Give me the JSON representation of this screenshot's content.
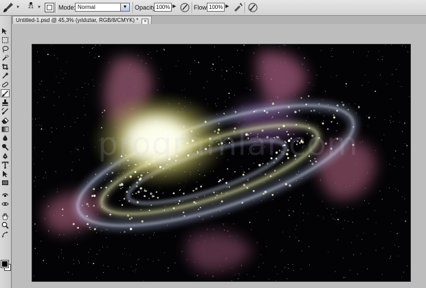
{
  "options_bar": {
    "brush_size": "21",
    "mode_label": "Mode:",
    "mode_value": "Normal",
    "opacity_label": "Opacity:",
    "opacity_value": "100%",
    "flow_label": "Flow:",
    "flow_value": "100%",
    "icons": [
      "brush-tool-icon",
      "brush-panel-toggle-icon",
      "pen-pressure-opacity-icon",
      "airbrush-icon",
      "pen-pressure-size-icon"
    ]
  },
  "document": {
    "tab_title": "Untitled-1.psd @ 45,3% (yıldızlar, RGB/8/CMYK) *",
    "close_glyph": "×"
  },
  "canvas": {
    "watermark": "programlar.com",
    "background_color": "#030305"
  },
  "tools": [
    "move-tool",
    "marquee-tool",
    "lasso-tool",
    "quick-selection-tool",
    "crop-tool",
    "eyedropper-tool",
    "spot-healing-tool",
    "brush-tool",
    "clone-stamp-tool",
    "history-brush-tool",
    "eraser-tool",
    "gradient-tool",
    "blur-tool",
    "dodge-tool",
    "pen-tool",
    "type-tool",
    "path-selection-tool",
    "rectangle-tool",
    "3d-rotate-tool",
    "3d-orbit-tool",
    "hand-tool",
    "zoom-tool"
  ],
  "colors": {
    "foreground": "#000000",
    "background": "#ffffff",
    "galaxy_core": "#f6f4b8",
    "nebula": "#c46b84"
  }
}
